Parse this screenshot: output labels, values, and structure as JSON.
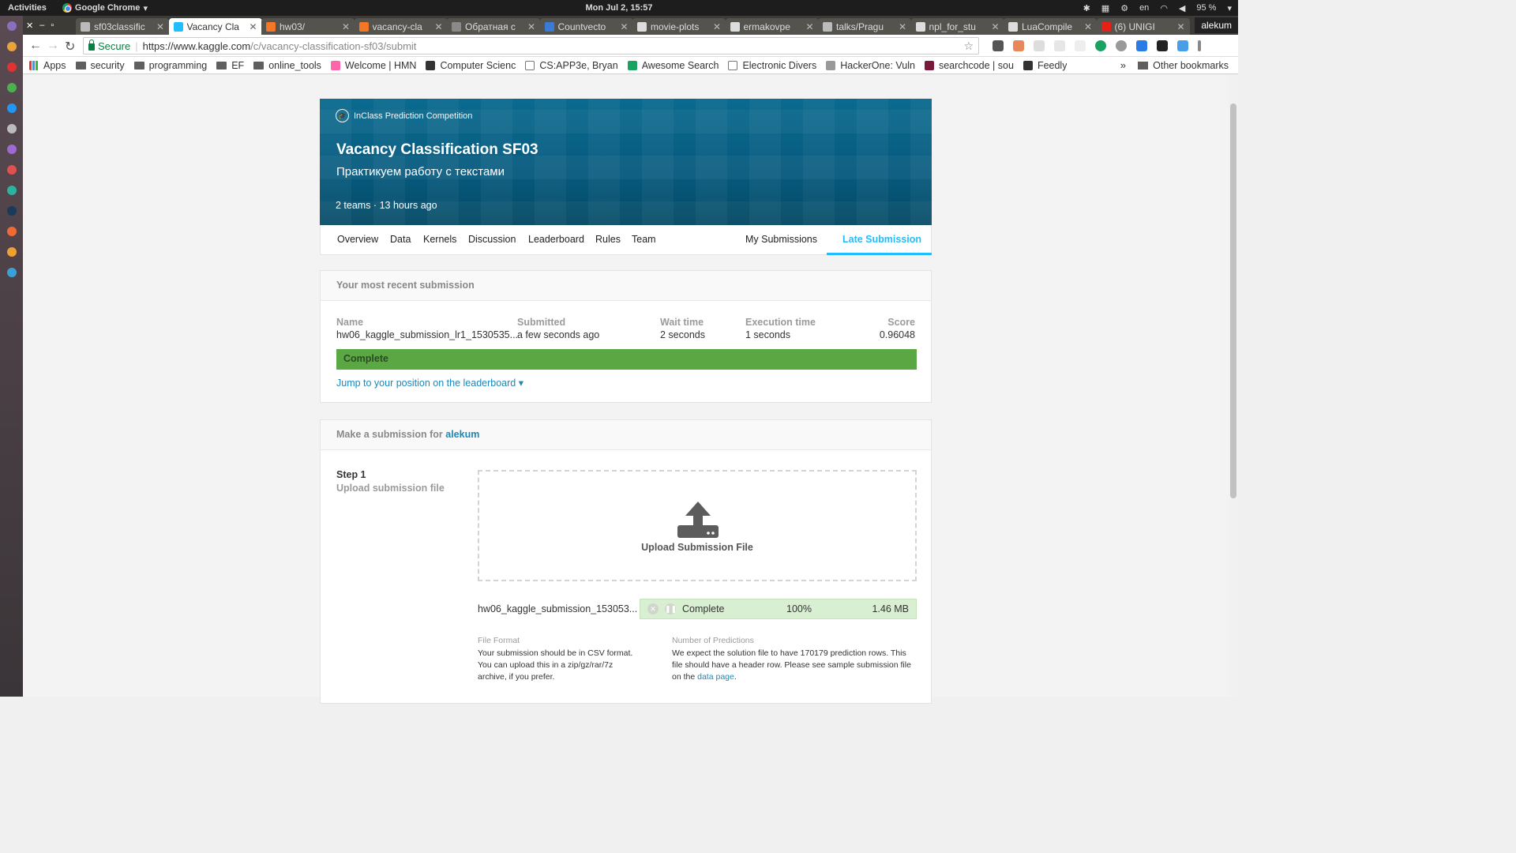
{
  "system": {
    "activities": "Activities",
    "app_name": "Google Chrome",
    "clock": "Mon Jul 2, 15:57",
    "lang": "en",
    "battery": "95 %"
  },
  "tabs": [
    {
      "label": "sf03classific",
      "icon": "doc-icon",
      "active": false
    },
    {
      "label": "Vacancy Cla",
      "icon": "kaggle-icon",
      "active": true
    },
    {
      "label": "hw03/",
      "icon": "jupyter-icon",
      "active": false
    },
    {
      "label": "vacancy-cla",
      "icon": "jupyter-icon",
      "active": false
    },
    {
      "label": "Обратная с",
      "icon": "feedback-icon",
      "active": false
    },
    {
      "label": "Countvecto",
      "icon": "sklearn-icon",
      "active": false
    },
    {
      "label": "movie-plots",
      "icon": "github-icon",
      "active": false
    },
    {
      "label": "ermakovpe",
      "icon": "github-icon",
      "active": false
    },
    {
      "label": "talks/Pragu",
      "icon": "doc-icon",
      "active": false
    },
    {
      "label": "npl_for_stu",
      "icon": "github-icon",
      "active": false
    },
    {
      "label": "LuaCompile",
      "icon": "github-icon",
      "active": false
    },
    {
      "label": "(6) UNIGI",
      "icon": "youtube-icon",
      "active": false
    }
  ],
  "profile": "alekum",
  "omnibox": {
    "secure_label": "Secure",
    "url_host": "https://www.kaggle.com",
    "url_path": "/c/vacancy-classification-sf03/submit"
  },
  "bookmarks": [
    {
      "label": "Apps",
      "type": "apps"
    },
    {
      "label": "security",
      "type": "folder"
    },
    {
      "label": "programming",
      "type": "folder"
    },
    {
      "label": "EF",
      "type": "folder"
    },
    {
      "label": "online_tools",
      "type": "folder"
    },
    {
      "label": "Welcome | HMN",
      "type": "site"
    },
    {
      "label": "Computer Scienc",
      "type": "site"
    },
    {
      "label": "CS:APP3e, Bryan",
      "type": "page"
    },
    {
      "label": "Awesome Search",
      "type": "site"
    },
    {
      "label": "Electronic Divers",
      "type": "page"
    },
    {
      "label": "HackerOne: Vuln",
      "type": "site"
    },
    {
      "label": "searchcode | sou",
      "type": "site"
    },
    {
      "label": "Feedly",
      "type": "site"
    }
  ],
  "bookmarks_more": "»",
  "other_bookmarks": "Other bookmarks",
  "competition": {
    "kind": "InClass Prediction Competition",
    "title": "Vacancy Classification SF03",
    "subtitle": "Практикуем работу с текстами",
    "meta": "2 teams · 13 hours ago"
  },
  "nav": {
    "items": [
      "Overview",
      "Data",
      "Kernels",
      "Discussion",
      "Leaderboard",
      "Rules",
      "Team"
    ],
    "my_submissions": "My Submissions",
    "late_submission": "Late Submission"
  },
  "recent": {
    "header": "Your most recent submission",
    "columns": {
      "name": "Name",
      "submitted": "Submitted",
      "wait": "Wait time",
      "exec": "Execution time",
      "score": "Score"
    },
    "values": {
      "name": "hw06_kaggle_submission_lr1_1530535...",
      "submitted": "a few seconds ago",
      "wait": "2 seconds",
      "exec": "1 seconds",
      "score": "0.96048"
    },
    "status": "Complete",
    "jump_link": "Jump to your position on the leaderboard ▾"
  },
  "make_submission": {
    "header_prefix": "Make a submission for",
    "user": "alekum",
    "step_title": "Step 1",
    "step_desc": "Upload submission file",
    "dropzone_label": "Upload Submission File",
    "file_name": "hw06_kaggle_submission_153053...",
    "upload_status": "Complete",
    "upload_percent": "100%",
    "upload_fraction": 1.0,
    "file_size": "1.46 MB",
    "file_format_title": "File Format",
    "file_format_text": "Your submission should be in CSV format. You can upload this in a zip/gz/rar/7z archive, if you prefer.",
    "predictions_title": "Number of Predictions",
    "predictions_text": "We expect the solution file to have 170179 prediction rows. This file should have a header row. Please see sample submission file on the",
    "predictions_link": "data page",
    "predictions_end": "."
  },
  "colors": {
    "hero": "#075a7e",
    "accent": "#20beff",
    "complete_green": "#5ba744",
    "link": "#1d87b7"
  }
}
